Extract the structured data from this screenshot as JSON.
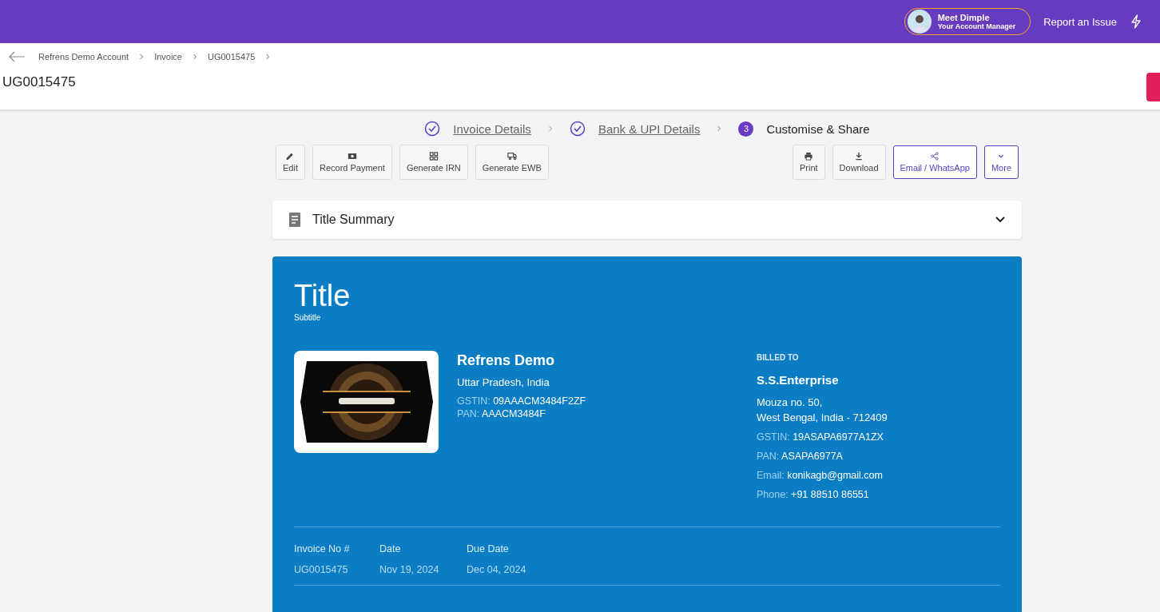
{
  "top_bar": {
    "manager": {
      "name": "Meet Dimple",
      "role": "Your Account Manager"
    },
    "report_link": "Report an Issue"
  },
  "breadcrumb": [
    "Refrens Demo Account",
    "Invoice",
    "UG0015475"
  ],
  "page_title": "UG0015475",
  "steps": [
    {
      "label": "Invoice Details",
      "completed": true
    },
    {
      "label": "Bank & UPI Details",
      "completed": true
    },
    {
      "label": "Customise & Share",
      "completed": false,
      "number": "3"
    }
  ],
  "actions_left": [
    {
      "label": "Edit",
      "kind": "plain"
    },
    {
      "label": "Record Payment",
      "kind": "plain"
    },
    {
      "label": "Generate IRN",
      "kind": "plain"
    },
    {
      "label": "Generate EWB",
      "kind": "plain"
    }
  ],
  "actions_right": [
    {
      "label": "Print",
      "kind": "plain"
    },
    {
      "label": "Download",
      "kind": "plain"
    },
    {
      "label": "Email / WhatsApp",
      "kind": "outlined"
    },
    {
      "label": "More",
      "kind": "outlined"
    }
  ],
  "summary": {
    "title": "Title Summary",
    "expanded": false
  },
  "invoice": {
    "title": "Title",
    "subtitle": "Subtitle",
    "seller": {
      "name": "Refrens Demo",
      "address": "Uttar Pradesh, India",
      "fields": [
        {
          "label": "GSTIN:",
          "value": "09AAACM3484F2ZF"
        },
        {
          "label": "PAN:",
          "value": "AAACM3484F"
        }
      ]
    },
    "billed_to": {
      "heading": "BILLED TO",
      "name": "S.S.Enterprise",
      "address": [
        "Mouza no. 50,",
        "West Bengal, India - 712409"
      ],
      "fields": [
        {
          "label": "GSTIN:",
          "value": "19ASAPA6977A1ZX"
        },
        {
          "label": "PAN:",
          "value": "ASAPA6977A"
        },
        {
          "label": "Email:",
          "value": "konikagb@gmail.com"
        },
        {
          "label": "Phone:",
          "value": "+91 88510 86551"
        }
      ]
    },
    "meta": [
      {
        "label": "Invoice No #",
        "value": "UG0015475"
      },
      {
        "label": "Date",
        "value": "Nov 19, 2024"
      },
      {
        "label": "Due Date",
        "value": "Dec 04, 2024"
      }
    ]
  }
}
